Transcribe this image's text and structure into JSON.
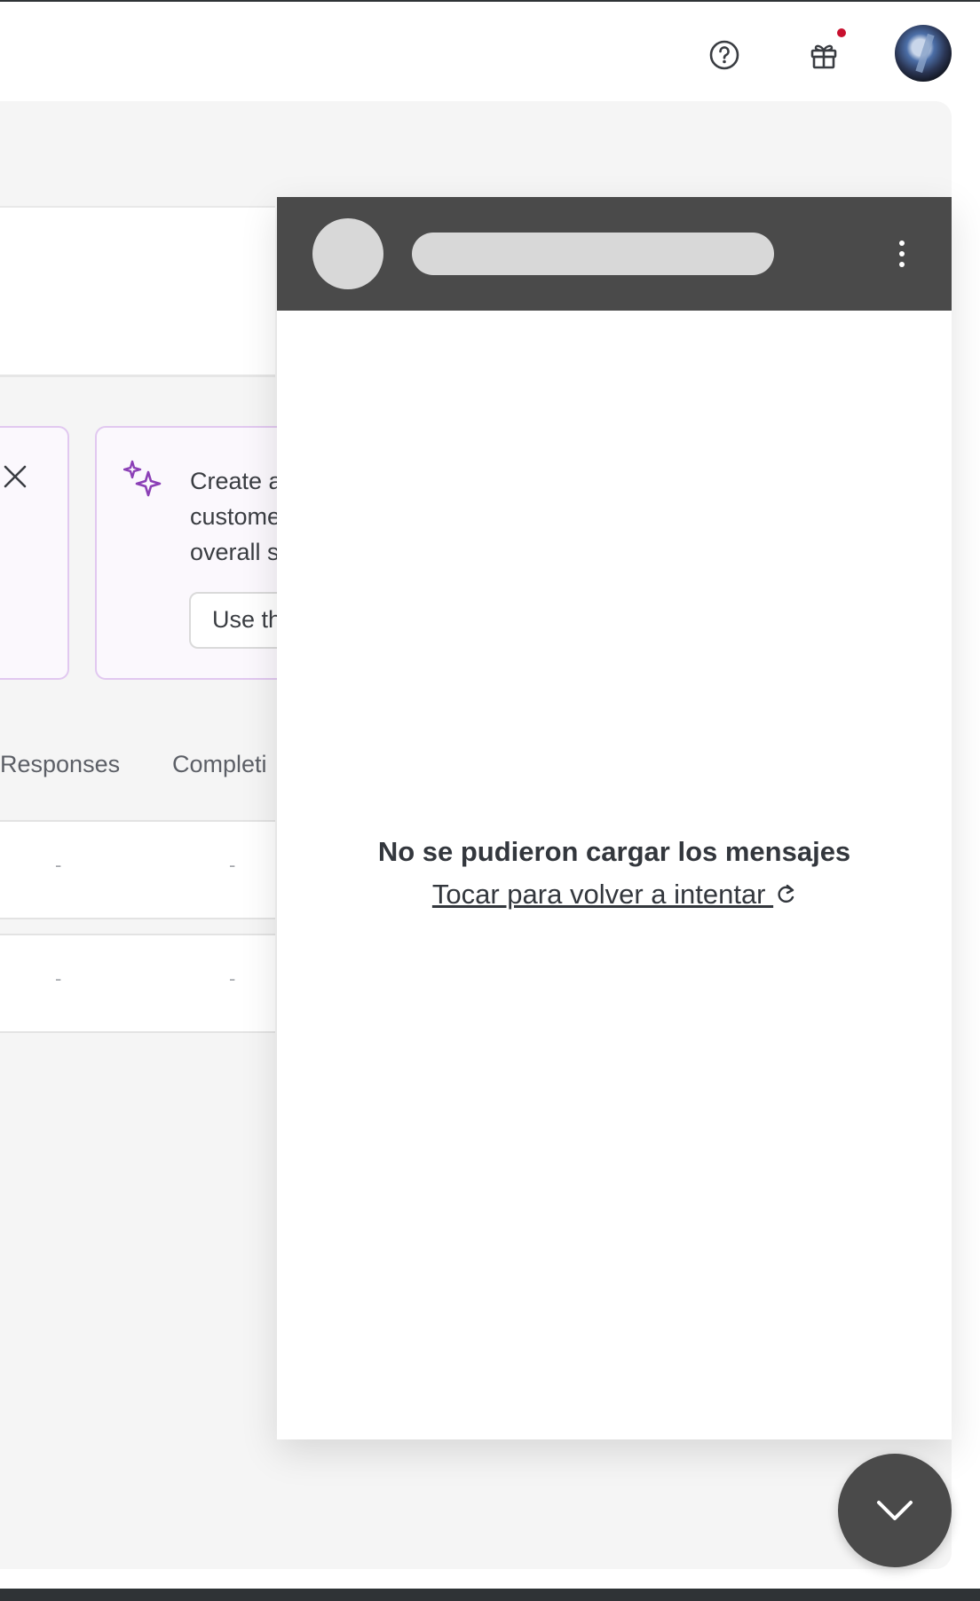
{
  "topbar": {
    "icons": [
      "help-circle-icon",
      "gift-icon",
      "avatar-image"
    ],
    "notification_dot_color": "#c8102e"
  },
  "promo": {
    "text": "Create a\ncustome\noverall s",
    "button_label": "Use th"
  },
  "table": {
    "columns": [
      "Responses",
      "Completi"
    ],
    "rows": [
      [
        "-",
        "-"
      ],
      [
        "-",
        "-"
      ]
    ]
  },
  "chat": {
    "error_title": "No se pudieron cargar los mensajes",
    "retry_label": "Tocar para volver a intentar ",
    "header_color": "#4a4a4a"
  },
  "colors": {
    "accent_purple": "#8b3fb6",
    "card_border": "#e1c8f0",
    "background": "#f5f5f5"
  }
}
